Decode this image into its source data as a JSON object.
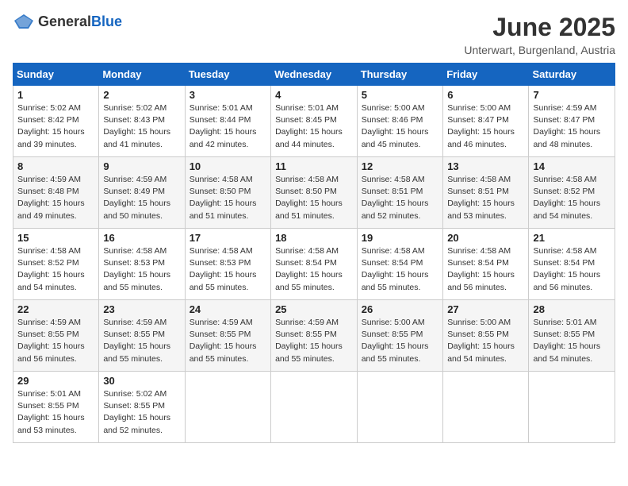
{
  "logo": {
    "general": "General",
    "blue": "Blue"
  },
  "title": "June 2025",
  "subtitle": "Unterwart, Burgenland, Austria",
  "headers": [
    "Sunday",
    "Monday",
    "Tuesday",
    "Wednesday",
    "Thursday",
    "Friday",
    "Saturday"
  ],
  "weeks": [
    [
      {
        "day": "1",
        "info": "Sunrise: 5:02 AM\nSunset: 8:42 PM\nDaylight: 15 hours\nand 39 minutes."
      },
      {
        "day": "2",
        "info": "Sunrise: 5:02 AM\nSunset: 8:43 PM\nDaylight: 15 hours\nand 41 minutes."
      },
      {
        "day": "3",
        "info": "Sunrise: 5:01 AM\nSunset: 8:44 PM\nDaylight: 15 hours\nand 42 minutes."
      },
      {
        "day": "4",
        "info": "Sunrise: 5:01 AM\nSunset: 8:45 PM\nDaylight: 15 hours\nand 44 minutes."
      },
      {
        "day": "5",
        "info": "Sunrise: 5:00 AM\nSunset: 8:46 PM\nDaylight: 15 hours\nand 45 minutes."
      },
      {
        "day": "6",
        "info": "Sunrise: 5:00 AM\nSunset: 8:47 PM\nDaylight: 15 hours\nand 46 minutes."
      },
      {
        "day": "7",
        "info": "Sunrise: 4:59 AM\nSunset: 8:47 PM\nDaylight: 15 hours\nand 48 minutes."
      }
    ],
    [
      {
        "day": "8",
        "info": "Sunrise: 4:59 AM\nSunset: 8:48 PM\nDaylight: 15 hours\nand 49 minutes."
      },
      {
        "day": "9",
        "info": "Sunrise: 4:59 AM\nSunset: 8:49 PM\nDaylight: 15 hours\nand 50 minutes."
      },
      {
        "day": "10",
        "info": "Sunrise: 4:58 AM\nSunset: 8:50 PM\nDaylight: 15 hours\nand 51 minutes."
      },
      {
        "day": "11",
        "info": "Sunrise: 4:58 AM\nSunset: 8:50 PM\nDaylight: 15 hours\nand 51 minutes."
      },
      {
        "day": "12",
        "info": "Sunrise: 4:58 AM\nSunset: 8:51 PM\nDaylight: 15 hours\nand 52 minutes."
      },
      {
        "day": "13",
        "info": "Sunrise: 4:58 AM\nSunset: 8:51 PM\nDaylight: 15 hours\nand 53 minutes."
      },
      {
        "day": "14",
        "info": "Sunrise: 4:58 AM\nSunset: 8:52 PM\nDaylight: 15 hours\nand 54 minutes."
      }
    ],
    [
      {
        "day": "15",
        "info": "Sunrise: 4:58 AM\nSunset: 8:52 PM\nDaylight: 15 hours\nand 54 minutes."
      },
      {
        "day": "16",
        "info": "Sunrise: 4:58 AM\nSunset: 8:53 PM\nDaylight: 15 hours\nand 55 minutes."
      },
      {
        "day": "17",
        "info": "Sunrise: 4:58 AM\nSunset: 8:53 PM\nDaylight: 15 hours\nand 55 minutes."
      },
      {
        "day": "18",
        "info": "Sunrise: 4:58 AM\nSunset: 8:54 PM\nDaylight: 15 hours\nand 55 minutes."
      },
      {
        "day": "19",
        "info": "Sunrise: 4:58 AM\nSunset: 8:54 PM\nDaylight: 15 hours\nand 55 minutes."
      },
      {
        "day": "20",
        "info": "Sunrise: 4:58 AM\nSunset: 8:54 PM\nDaylight: 15 hours\nand 56 minutes."
      },
      {
        "day": "21",
        "info": "Sunrise: 4:58 AM\nSunset: 8:54 PM\nDaylight: 15 hours\nand 56 minutes."
      }
    ],
    [
      {
        "day": "22",
        "info": "Sunrise: 4:59 AM\nSunset: 8:55 PM\nDaylight: 15 hours\nand 56 minutes."
      },
      {
        "day": "23",
        "info": "Sunrise: 4:59 AM\nSunset: 8:55 PM\nDaylight: 15 hours\nand 55 minutes."
      },
      {
        "day": "24",
        "info": "Sunrise: 4:59 AM\nSunset: 8:55 PM\nDaylight: 15 hours\nand 55 minutes."
      },
      {
        "day": "25",
        "info": "Sunrise: 4:59 AM\nSunset: 8:55 PM\nDaylight: 15 hours\nand 55 minutes."
      },
      {
        "day": "26",
        "info": "Sunrise: 5:00 AM\nSunset: 8:55 PM\nDaylight: 15 hours\nand 55 minutes."
      },
      {
        "day": "27",
        "info": "Sunrise: 5:00 AM\nSunset: 8:55 PM\nDaylight: 15 hours\nand 54 minutes."
      },
      {
        "day": "28",
        "info": "Sunrise: 5:01 AM\nSunset: 8:55 PM\nDaylight: 15 hours\nand 54 minutes."
      }
    ],
    [
      {
        "day": "29",
        "info": "Sunrise: 5:01 AM\nSunset: 8:55 PM\nDaylight: 15 hours\nand 53 minutes."
      },
      {
        "day": "30",
        "info": "Sunrise: 5:02 AM\nSunset: 8:55 PM\nDaylight: 15 hours\nand 52 minutes."
      },
      {
        "day": "",
        "info": ""
      },
      {
        "day": "",
        "info": ""
      },
      {
        "day": "",
        "info": ""
      },
      {
        "day": "",
        "info": ""
      },
      {
        "day": "",
        "info": ""
      }
    ]
  ]
}
